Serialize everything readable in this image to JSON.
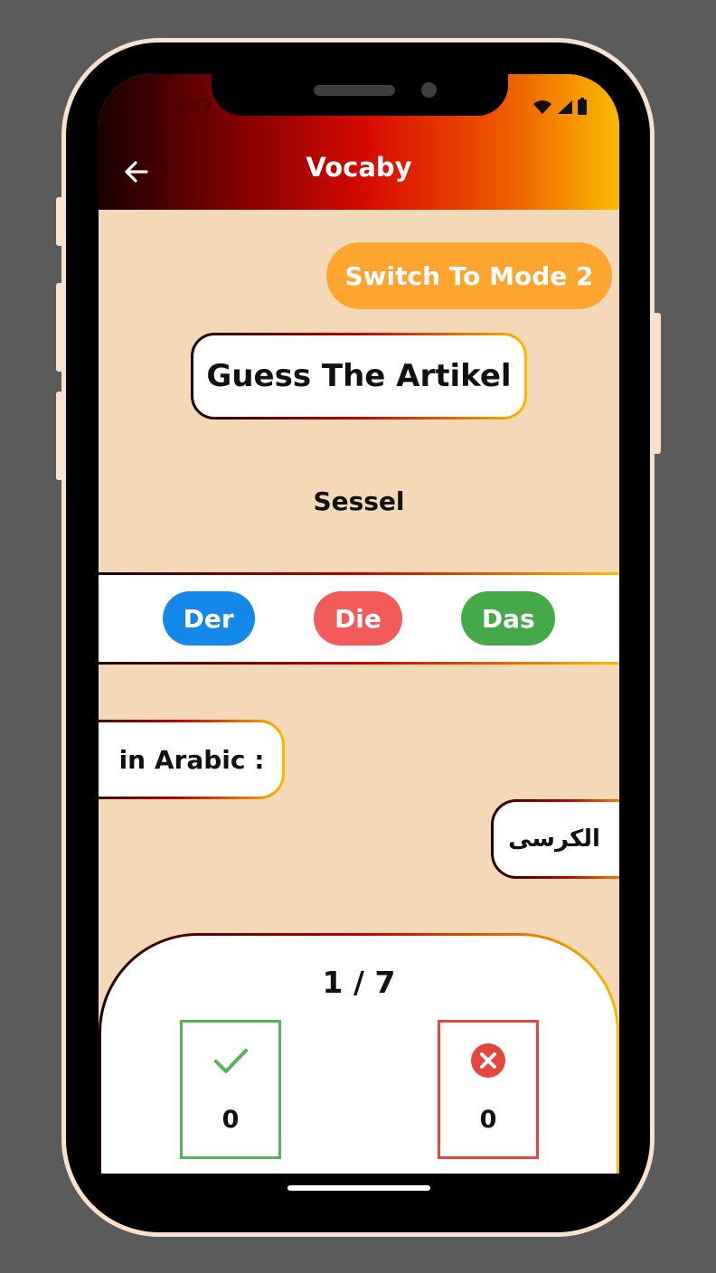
{
  "status_bar": {
    "time": "9:43"
  },
  "header": {
    "title": "Vocaby"
  },
  "mode_button": {
    "label": "Switch To Mode 2"
  },
  "quiz": {
    "title": "Guess The Artikel",
    "word": "Sessel",
    "options": [
      "Der",
      "Die",
      "Das"
    ],
    "translation_label": "in Arabic :",
    "translation": "الكرسى"
  },
  "score": {
    "progress": "1 / 7",
    "correct": "0",
    "wrong": "0"
  },
  "colors": {
    "der": "#1488e8",
    "die": "#f35a5a",
    "das": "#45a94a",
    "mode_button": "#fea530",
    "background": "#f3d9b8"
  },
  "icons": [
    "back-arrow-icon",
    "wifi-icon",
    "signal-icon",
    "battery-icon",
    "check-icon",
    "close-circle-icon"
  ]
}
